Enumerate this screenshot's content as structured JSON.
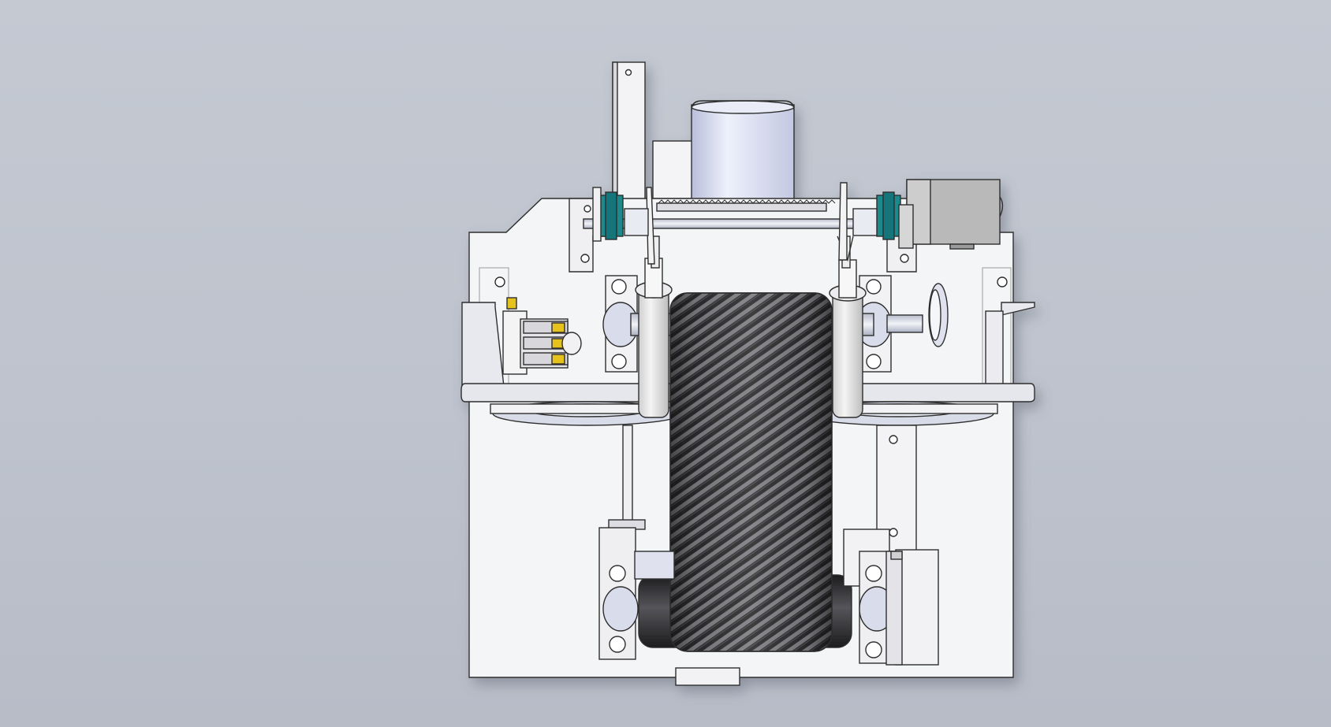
{
  "viewport": {
    "background_top": "#c4c9d2",
    "background_bottom": "#b7bcc7"
  },
  "model": {
    "type": "3d-cad-assembly",
    "view": "front",
    "components": [
      "main-base-plate",
      "lower-mounting-plate",
      "upper-left-bracket",
      "upper-right-bracket",
      "drive-motor",
      "motor-junction-box",
      "left-vertical-arm",
      "gear-rack",
      "horizontal-shaft",
      "left-shaft-collar",
      "right-shaft-collar",
      "right-gearbox",
      "left-guide-cylinder",
      "right-guide-cylinder",
      "woven-belt-drum",
      "left-pillow-block-bearing",
      "right-pillow-block-bearing",
      "left-lower-pillow-block",
      "right-lower-pillow-block",
      "lower-drive-roller",
      "pneumatic-valve-block",
      "right-handwheel",
      "left-pulley",
      "right-pulley",
      "left-side-plate",
      "right-side-plate",
      "bottom-tab",
      "right-electrical-box"
    ],
    "colors": {
      "plate": "#f4f5f7",
      "edge": "#3a3a3a",
      "metal": "#d4d7e4",
      "motor": "#d6daf0",
      "teal_collar": "#1e8a8c",
      "belt_dark": "#2c2c2e",
      "belt_light": "#8c8c90",
      "yellow_fitting": "#e5c21a",
      "roller_dark": "#2e2e30",
      "gearbox": "#b9b9b9"
    }
  }
}
